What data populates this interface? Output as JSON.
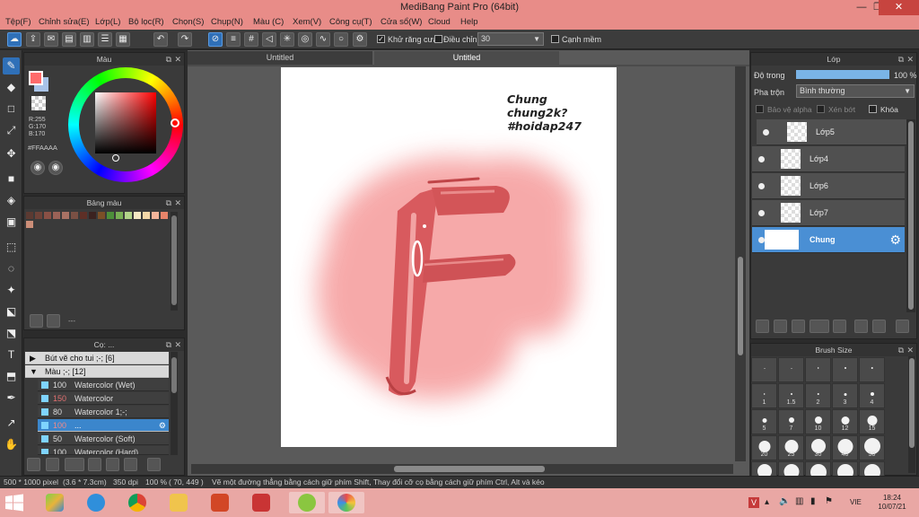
{
  "window": {
    "title": "MediBang Paint Pro (64bit)",
    "min": "—",
    "restore": "❐",
    "close": "✕"
  },
  "menu": [
    "Tệp(F)",
    "Chỉnh sửa(E)",
    "Lớp(L)",
    "Bộ lọc(R)",
    "Chọn(S)",
    "Chụp(N)",
    "Màu (C)",
    "Xem(V)",
    "Công cụ(T)",
    "Cửa sổ(W)",
    "Cloud",
    "Help"
  ],
  "toolbar": {
    "antialias_label": "Khử răng cưa",
    "correction_label": "Điều chỉnh",
    "correction_value": "30",
    "soft_edge_label": "Cạnh mềm"
  },
  "color_panel": {
    "title": "Màu",
    "r": "R:255",
    "g": "G:170",
    "b": "B:170",
    "hex": "#FFAAAA",
    "primary": "#ff6b6b",
    "secondary": "#a9c3e8"
  },
  "palette_panel": {
    "title": "Bảng màu",
    "swatches": [
      "#5c3a32",
      "#6e4238",
      "#8a5045",
      "#9b6257",
      "#a87264",
      "#7a5044",
      "#5e2f26",
      "#3b2220",
      "#7b4f27",
      "#4c8f3a",
      "#79b055",
      "#b2d489",
      "#f5e9c4",
      "#f4d7a7",
      "#f3b49a",
      "#e8846a",
      "#cc8e78"
    ],
    "count": "---"
  },
  "brush_panel": {
    "title": "Cọ: ...",
    "groups": [
      {
        "label": "Bút vẽ cho tui ;-; [6]",
        "arrow": "▶"
      },
      {
        "label": "Màu ;-; [12]",
        "arrow": "▼"
      }
    ],
    "items": [
      {
        "size": "100",
        "name": "Watercolor (Wet)"
      },
      {
        "size": "150",
        "name": "Watercolor"
      },
      {
        "size": "80",
        "name": "Watercolor 1;-;"
      },
      {
        "size": "100",
        "name": "..."
      },
      {
        "size": "50",
        "name": "Watercolor (Soft)"
      },
      {
        "size": "100",
        "name": "Watercolor (Hard)"
      }
    ]
  },
  "canvas": {
    "tab1": "Untitled",
    "tab2": "Untitled",
    "note_line1": "Chung",
    "note_line2": "chung2k?",
    "note_line3": "#hoidap247"
  },
  "layers_panel": {
    "title": "Lớp",
    "opacity_label": "Độ trong",
    "opacity_value": "100 %",
    "opacity_fraction": 1.0,
    "blend_label": "Pha trộn",
    "blend_value": "Bình thường",
    "protect_alpha": "Bảo vệ alpha",
    "clipping": "Xén bớt",
    "lock": "Khóa",
    "layers": [
      {
        "name": "Lớp5",
        "selected": false
      },
      {
        "name": "Lớp4",
        "selected": false
      },
      {
        "name": "Lớp6",
        "selected": false
      },
      {
        "name": "Lớp7",
        "selected": false
      },
      {
        "name": "Chung",
        "selected": true
      }
    ]
  },
  "brush_size_panel": {
    "title": "Brush Size",
    "rows": [
      [
        "",
        "",
        "",
        "",
        ""
      ],
      [
        "1",
        "1.5",
        "2",
        "3",
        "4"
      ],
      [
        "5",
        "7",
        "10",
        "12",
        "15"
      ],
      [
        "20",
        "25",
        "30",
        "40",
        "50"
      ],
      [
        "",
        "",
        "",
        "",
        ""
      ]
    ]
  },
  "status": {
    "size": "500 * 1000 pixel",
    "cm": "(3.6 * 7.3cm)",
    "dpi": "350 dpi",
    "zoom": "100 %",
    "coords": "( 70, 449 )",
    "hint": "Vẽ một đường thẳng bằng cách giữ phím Shift, Thay đổi cỡ cọ bằng cách giữ phím Ctrl, Alt và kéo"
  },
  "taskbar": {
    "lang": "VIE",
    "time": "18:24",
    "date": "10/07/21"
  }
}
